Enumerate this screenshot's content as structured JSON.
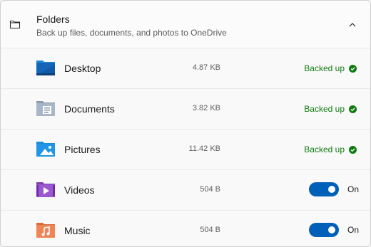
{
  "header": {
    "title": "Folders",
    "subtitle": "Back up files, documents, and photos to OneDrive",
    "icon": "folder-icon",
    "collapse_icon": "chevron-up-icon"
  },
  "folders": [
    {
      "name": "Desktop",
      "size": "4.87 KB",
      "status": "Backed up",
      "icon": "desktop-folder-icon"
    },
    {
      "name": "Documents",
      "size": "3.82 KB",
      "status": "Backed up",
      "icon": "documents-folder-icon"
    },
    {
      "name": "Pictures",
      "size": "11.42 KB",
      "status": "Backed up",
      "icon": "pictures-folder-icon"
    },
    {
      "name": "Videos",
      "size": "504 B",
      "toggle_label": "On",
      "toggle_on": true,
      "icon": "videos-folder-icon"
    },
    {
      "name": "Music",
      "size": "504 B",
      "toggle_label": "On",
      "toggle_on": true,
      "icon": "music-folder-icon"
    }
  ],
  "colors": {
    "accent": "#005fb8",
    "success": "#0f7b0f"
  }
}
